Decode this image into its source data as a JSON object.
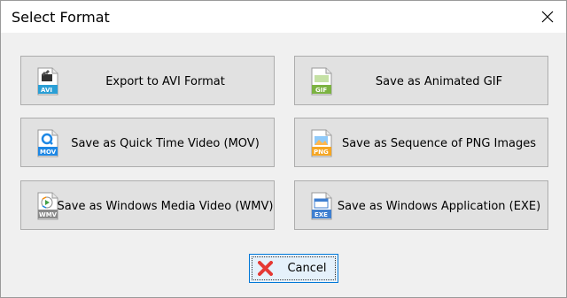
{
  "window": {
    "title": "Select Format"
  },
  "buttons": [
    {
      "label": "Export to AVI Format",
      "icon": "avi-file-icon",
      "tag": "AVI",
      "accent": "#2a9fd6"
    },
    {
      "label": "Save as Animated GIF",
      "icon": "gif-file-icon",
      "tag": "GIF",
      "accent": "#7cb342"
    },
    {
      "label": "Save as Quick Time Video (MOV)",
      "icon": "mov-file-icon",
      "tag": "MOV",
      "accent": "#1e88e5"
    },
    {
      "label": "Save as Sequence of PNG Images",
      "icon": "png-file-icon",
      "tag": "PNG",
      "accent": "#f5a623"
    },
    {
      "label": "Save as Windows Media Video (WMV)",
      "icon": "wmv-file-icon",
      "tag": "WMV",
      "accent": "#8a8a8a"
    },
    {
      "label": "Save as Windows Application (EXE)",
      "icon": "exe-file-icon",
      "tag": "EXE",
      "accent": "#3f7fd0"
    }
  ],
  "cancel": {
    "label": "Cancel",
    "icon": "red-x-icon",
    "color": "#e53935"
  }
}
